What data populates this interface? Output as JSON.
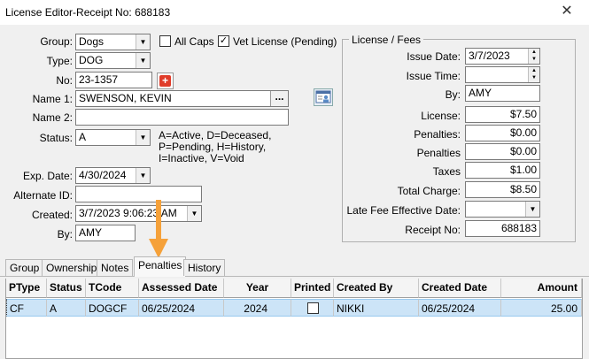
{
  "window": {
    "title": "License Editor-Receipt No: 688183"
  },
  "form": {
    "group": {
      "label": "Group:",
      "value": "Dogs"
    },
    "all_caps": {
      "label": "All Caps",
      "checked": false
    },
    "vet_license": {
      "label": "Vet License (Pending)",
      "checked": true
    },
    "type": {
      "label": "Type:",
      "value": "DOG"
    },
    "no": {
      "label": "No:",
      "value": "23-1357"
    },
    "name1": {
      "label": "Name 1:",
      "value": "SWENSON, KEVIN",
      "button": "..."
    },
    "name2": {
      "label": "Name 2:",
      "value": ""
    },
    "status": {
      "label": "Status:",
      "value": "A",
      "legend": [
        "A=Active, D=Deceased,",
        "P=Pending, H=History,",
        "I=Inactive,  V=Void"
      ]
    },
    "exp_date": {
      "label": "Exp. Date:",
      "value": "4/30/2024"
    },
    "alternate_id": {
      "label": "Alternate ID:",
      "value": ""
    },
    "created": {
      "label": "Created:",
      "value": "3/7/2023 9:06:23 AM"
    },
    "by": {
      "label": "By:",
      "value": "AMY"
    }
  },
  "fees": {
    "title": "License / Fees",
    "issue_date": {
      "label": "Issue Date:",
      "value": "3/7/2023"
    },
    "issue_time": {
      "label": "Issue Time:",
      "value": ""
    },
    "by": {
      "label": "By:",
      "value": "AMY"
    },
    "license": {
      "label": "License:",
      "value": "$7.50"
    },
    "penalties1": {
      "label": "Penalties:",
      "value": "$0.00"
    },
    "penalties2": {
      "label": "Penalties",
      "value": "$0.00"
    },
    "taxes": {
      "label": "Taxes",
      "value": "$1.00"
    },
    "total_charge": {
      "label": "Total Charge:",
      "value": "$8.50"
    },
    "late_fee": {
      "label": "Late Fee Effective Date:",
      "value": ""
    },
    "receipt_no": {
      "label": "Receipt No:",
      "value": "688183"
    }
  },
  "tabs": [
    "Group",
    "Ownership",
    "Notes",
    "Penalties",
    "History"
  ],
  "active_tab": "Penalties",
  "grid": {
    "columns": [
      "PType",
      "Status",
      "TCode",
      "Assessed Date",
      "Year",
      "Printed",
      "Created By",
      "Created Date",
      "Amount"
    ],
    "rows": [
      {
        "ptype": "CF",
        "status": "A",
        "tcode": "DOGCF",
        "assessed_date": "06/25/2024",
        "year": "2024",
        "printed": false,
        "created_by": "NIKKI",
        "created_date": "06/25/2024",
        "amount": "25.00"
      }
    ]
  },
  "colors": {
    "selection": "#cce4f7",
    "arrow": "#f5a13a",
    "plus": "#e03c2a"
  },
  "icons": {
    "close": "close-icon",
    "add": "plus-icon",
    "card": "id-card-icon",
    "dropdown": "chevron-down-icon"
  }
}
